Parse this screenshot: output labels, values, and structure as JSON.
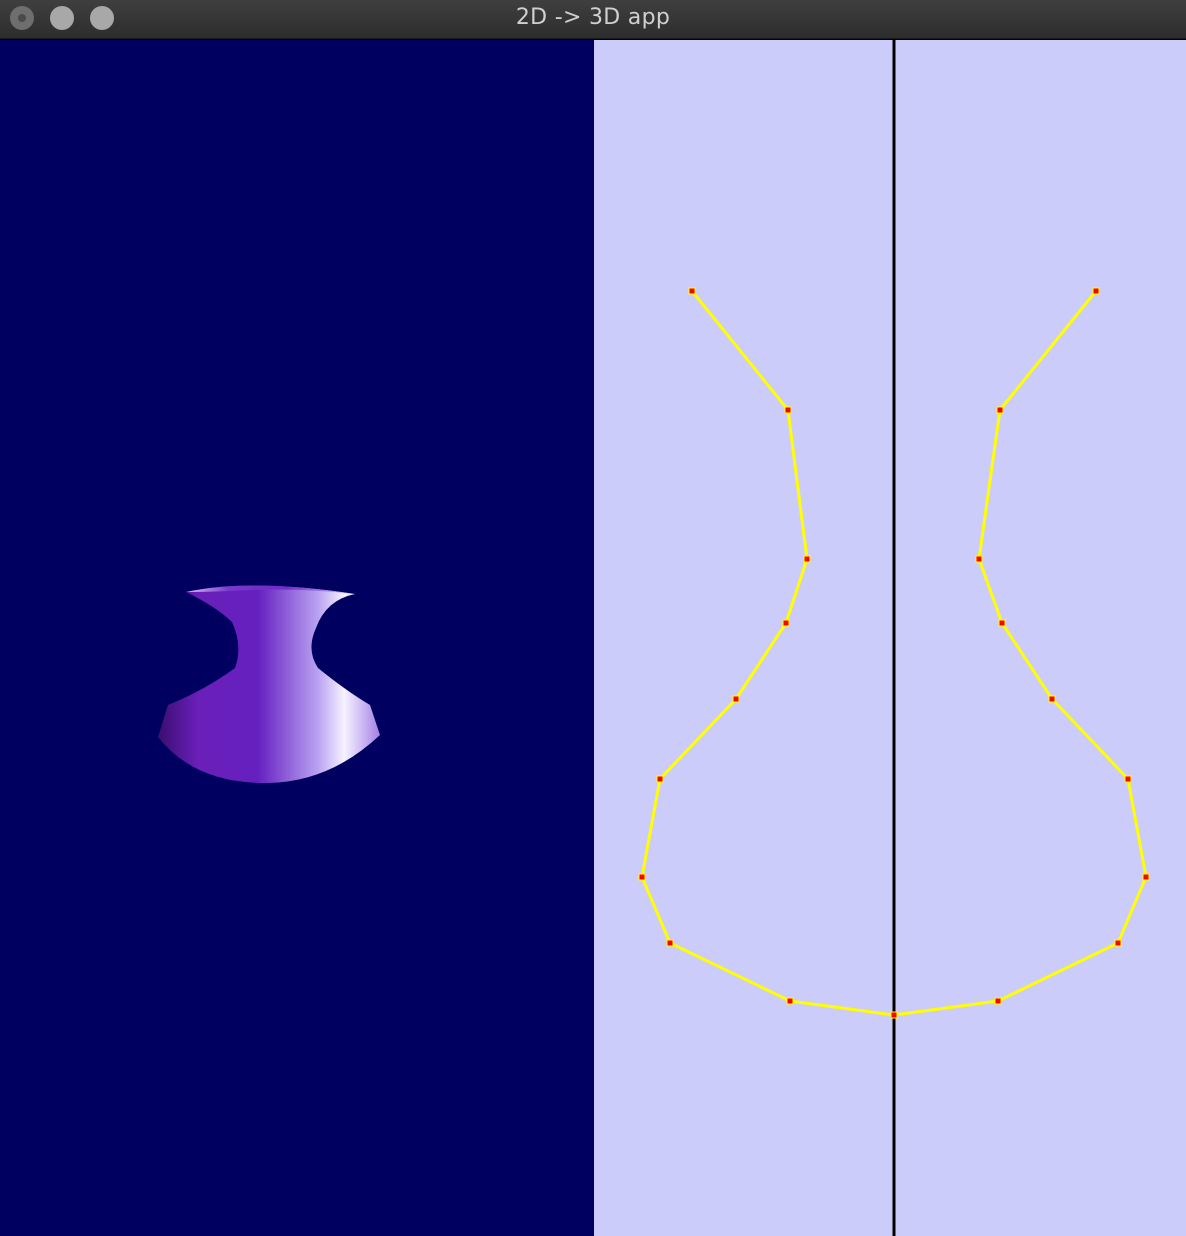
{
  "window": {
    "title": "2D -> 3D app",
    "buttons": [
      "close-button",
      "minimize-button",
      "maximize-button"
    ]
  },
  "colors": {
    "viewport_background": "#000060",
    "editor_background": "#ccccfb",
    "axis_line": "#000000",
    "profile_line": "#ffff00",
    "control_point": "#ff0000",
    "vase_dark": "#5a18a8",
    "vase_light": "#f4f0ff"
  },
  "icons": {
    "close": "circle-dot-icon",
    "minimize": "circle-icon",
    "maximize": "circle-icon"
  }
}
